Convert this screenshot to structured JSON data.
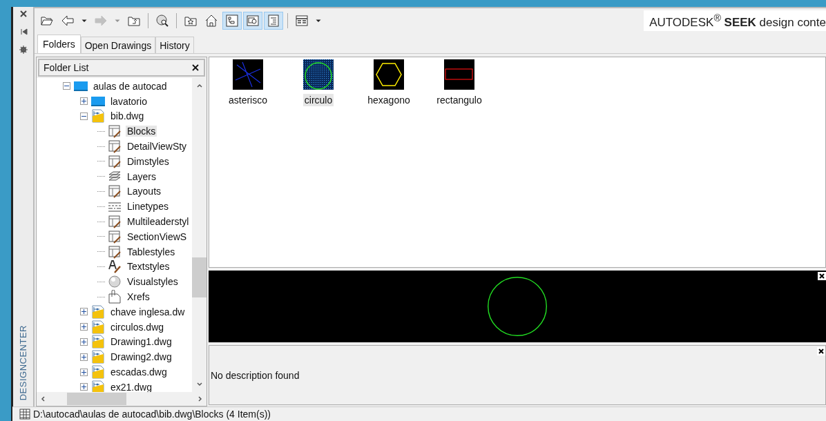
{
  "palette": {
    "title": "DESIGNCENTER"
  },
  "toolbar": [
    [
      {
        "kind": "load",
        "on": false,
        "disabled": false
      },
      {
        "kind": "back",
        "on": false,
        "disabled": false
      },
      {
        "kind": "caret",
        "on": false,
        "disabled": false
      },
      {
        "kind": "forward",
        "on": false,
        "disabled": true
      },
      {
        "kind": "caret",
        "on": false,
        "disabled": true
      },
      {
        "kind": "up",
        "on": false,
        "disabled": false
      }
    ],
    [
      {
        "kind": "search",
        "on": false,
        "disabled": false
      }
    ],
    [
      {
        "kind": "favorites",
        "on": false,
        "disabled": false
      },
      {
        "kind": "home",
        "on": false,
        "disabled": false
      },
      {
        "kind": "tree",
        "on": true,
        "disabled": false
      },
      {
        "kind": "preview",
        "on": true,
        "disabled": false
      },
      {
        "kind": "description",
        "on": true,
        "disabled": false
      }
    ],
    [
      {
        "kind": "views",
        "on": false,
        "disabled": false
      },
      {
        "kind": "caret",
        "on": false,
        "disabled": false
      }
    ]
  ],
  "brand": "AUTODESK$^{®}$ **SEEK** design conte",
  "tabs": [
    {
      "label": "Folders",
      "selected": true
    },
    {
      "label": "Open Drawings",
      "selected": false
    },
    {
      "label": "History",
      "selected": false
    }
  ],
  "folder_list": {
    "title": "Folder List",
    "tree": [
      {
        "label": "aulas de autocad",
        "kind": "folder",
        "expanded": true,
        "selected": false,
        "children": [
          {
            "label": "lavatorio",
            "kind": "folder",
            "expanded": false,
            "selected": false
          },
          {
            "label": "bib.dwg",
            "kind": "dwg",
            "expanded": true,
            "selected": false,
            "children": [
              {
                "label": "Blocks",
                "kind": "blocks",
                "selected": true
              },
              {
                "label": "DetailViewSty",
                "kind": "detail",
                "selected": false
              },
              {
                "label": "Dimstyles",
                "kind": "dim",
                "selected": false
              },
              {
                "label": "Layers",
                "kind": "layers",
                "selected": false
              },
              {
                "label": "Layouts",
                "kind": "layouts",
                "selected": false
              },
              {
                "label": "Linetypes",
                "kind": "linetypes",
                "selected": false
              },
              {
                "label": "Multileaderstyl",
                "kind": "leader",
                "selected": false
              },
              {
                "label": "SectionViewS",
                "kind": "section",
                "selected": false
              },
              {
                "label": "Tablestyles",
                "kind": "table",
                "selected": false
              },
              {
                "label": "Textstyles",
                "kind": "text",
                "selected": false
              },
              {
                "label": "Visualstyles",
                "kind": "visual",
                "selected": false
              },
              {
                "label": "Xrefs",
                "kind": "xrefs",
                "selected": false
              }
            ]
          },
          {
            "label": "chave inglesa.dw",
            "kind": "dwg",
            "expanded": false,
            "selected": false
          },
          {
            "label": "circulos.dwg",
            "kind": "dwg",
            "expanded": false,
            "selected": false
          },
          {
            "label": "Drawing1.dwg",
            "kind": "dwg",
            "expanded": false,
            "selected": false
          },
          {
            "label": "Drawing2.dwg",
            "kind": "dwg",
            "expanded": false,
            "selected": false
          },
          {
            "label": "escadas.dwg",
            "kind": "dwg",
            "expanded": false,
            "selected": false
          },
          {
            "label": "ex21.dwg",
            "kind": "dwg",
            "expanded": false,
            "selected": false
          }
        ]
      }
    ]
  },
  "items": [
    {
      "label": "asterisco",
      "kind": "asterisk",
      "selected": false
    },
    {
      "label": "circulo",
      "kind": "circle",
      "selected": true
    },
    {
      "label": "hexagono",
      "kind": "hexagon",
      "selected": false
    },
    {
      "label": "rectangulo",
      "kind": "rectangle",
      "selected": false
    }
  ],
  "preview": {
    "kind": "circle"
  },
  "description": "No description found",
  "status_bar": "D:\\autocad\\aulas de autocad\\bib.dwg\\Blocks (4 Item(s))"
}
